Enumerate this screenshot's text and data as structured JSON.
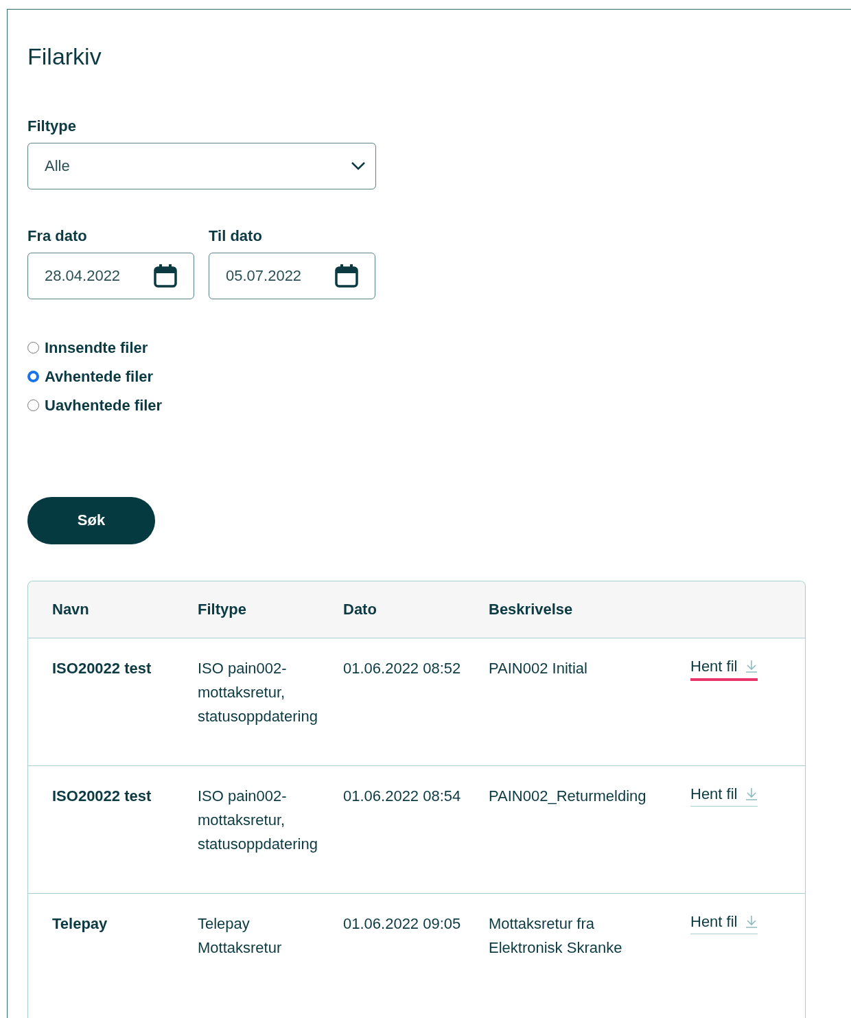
{
  "title": "Filarkiv",
  "filetype": {
    "label": "Filtype",
    "value": "Alle"
  },
  "dates": [
    {
      "label": "Fra dato",
      "value": "28.04.2022"
    },
    {
      "label": "Til dato",
      "value": "05.07.2022"
    }
  ],
  "radios": [
    {
      "label": "Innsendte filer",
      "selected": false
    },
    {
      "label": "Avhentede filer",
      "selected": true
    },
    {
      "label": "Uavhentede filer",
      "selected": false
    }
  ],
  "search_button": "Søk",
  "table": {
    "columns": [
      "Navn",
      "Filtype",
      "Dato",
      "Beskrivelse"
    ],
    "rows": [
      {
        "name": "ISO20022 test",
        "filetype": "ISO pain002-mottaksretur, statusoppdatering",
        "date": "01.06.2022 08:52",
        "description": "PAIN002 Initial",
        "link": "Hent fil",
        "focused": true
      },
      {
        "name": "ISO20022 test",
        "filetype": "ISO pain002-mottaksretur, statusoppdatering",
        "date": "01.06.2022 08:54",
        "description": "PAIN002_Returmelding",
        "link": "Hent fil",
        "focused": false
      },
      {
        "name": "Telepay",
        "filetype": "Telepay Mottaksretur",
        "date": "01.06.2022 09:05",
        "description": "Mottaksretur fra Elektronisk Skranke",
        "link": "Hent fil",
        "focused": false
      }
    ]
  }
}
